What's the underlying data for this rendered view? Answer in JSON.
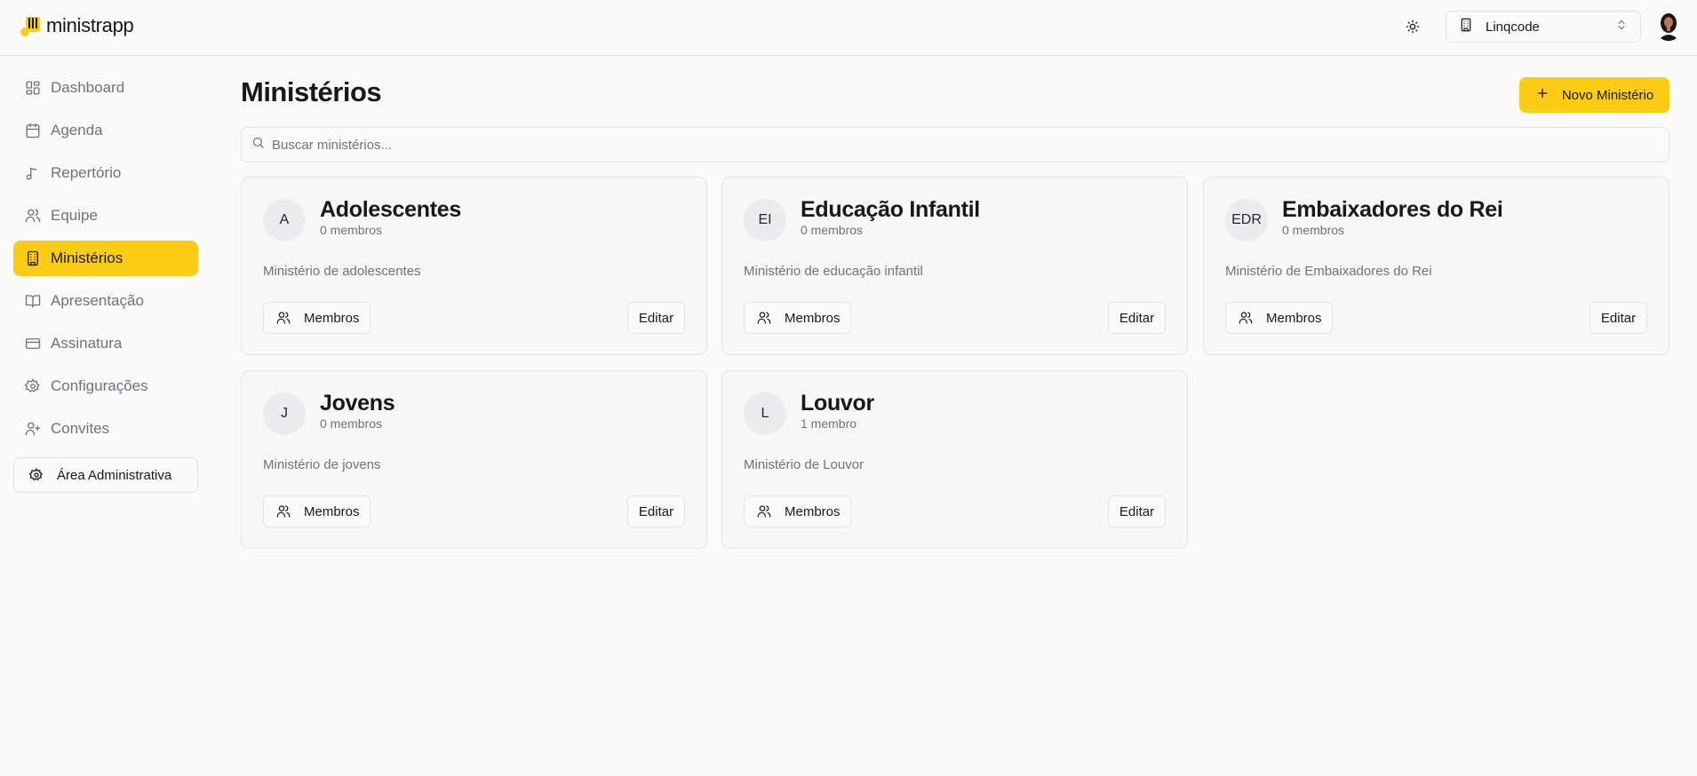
{
  "brand": {
    "name": "ministrapp",
    "accent": "#facc15",
    "logo_icon": "music-note-logo-icon"
  },
  "header": {
    "theme_icon": "sun-icon",
    "org_select": {
      "icon": "building-icon",
      "value": "Linqcode",
      "chevron": "chevrons-up-down-icon"
    },
    "avatar_alt": "user-avatar"
  },
  "sidebar": {
    "items": [
      {
        "label": "Dashboard",
        "icon": "layout-dashboard-icon",
        "active": false
      },
      {
        "label": "Agenda",
        "icon": "calendar-icon",
        "active": false
      },
      {
        "label": "Repertório",
        "icon": "music-note-icon",
        "active": false
      },
      {
        "label": "Equipe",
        "icon": "users-icon",
        "active": false
      },
      {
        "label": "Ministérios",
        "icon": "building-icon",
        "active": true
      },
      {
        "label": "Apresentação",
        "icon": "book-open-icon",
        "active": false
      },
      {
        "label": "Assinatura",
        "icon": "credit-card-icon",
        "active": false
      },
      {
        "label": "Configurações",
        "icon": "gear-icon",
        "active": false
      },
      {
        "label": "Convites",
        "icon": "user-plus-icon",
        "active": false
      }
    ],
    "admin_button": {
      "label": "Área Administrativa",
      "icon": "gear-icon"
    }
  },
  "main": {
    "title": "Ministérios",
    "new_button": {
      "label": "Novo Ministério",
      "icon": "plus-icon"
    },
    "search": {
      "placeholder": "Buscar ministérios...",
      "value": "",
      "icon": "search-icon"
    },
    "cards": [
      {
        "initials": "A",
        "name": "Adolescentes",
        "count": "0 membros",
        "description": "Ministério de adolescentes",
        "members_label": "Membros",
        "edit_label": "Editar"
      },
      {
        "initials": "EI",
        "name": "Educação Infantil",
        "count": "0 membros",
        "description": "Ministério de educação infantil",
        "members_label": "Membros",
        "edit_label": "Editar"
      },
      {
        "initials": "EDR",
        "name": "Embaixadores do Rei",
        "count": "0 membros",
        "description": "Ministério de Embaixadores do Rei",
        "members_label": "Membros",
        "edit_label": "Editar"
      },
      {
        "initials": "J",
        "name": "Jovens",
        "count": "0 membros",
        "description": "Ministério de jovens",
        "members_label": "Membros",
        "edit_label": "Editar"
      },
      {
        "initials": "L",
        "name": "Louvor",
        "count": "1 membro",
        "description": "Ministério de Louvor",
        "members_label": "Membros",
        "edit_label": "Editar"
      }
    ]
  }
}
